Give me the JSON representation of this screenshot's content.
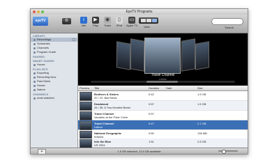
{
  "window": {
    "title": "EyeTV Programs"
  },
  "toolbar": {
    "logo_text": "eyeTV",
    "buttons": [
      {
        "label": "Info",
        "icon": "info-icon",
        "color": "#2d6fd0"
      },
      {
        "label": "Play",
        "icon": "play-icon",
        "color": "#3a3a3a"
      },
      {
        "label": "Toast",
        "icon": "toast-icon",
        "color": "#b0b0b0"
      },
      {
        "label": "iPod",
        "icon": "ipod-icon",
        "color": "#d8d8d8"
      },
      {
        "label": "Apple TV",
        "icon": "appletv-icon",
        "color": "#444"
      }
    ],
    "view_label": "View",
    "search_label": "Search"
  },
  "sidebar": {
    "sections": [
      {
        "header": "LIBRARY",
        "items": [
          {
            "label": "Recordings",
            "count": "32",
            "selected": true
          },
          {
            "label": "Schedules"
          },
          {
            "label": "Channels"
          },
          {
            "label": "Program Guide"
          }
        ]
      },
      {
        "header": "SHARED",
        "items": []
      },
      {
        "header": "SMART GUIDES",
        "items": [
          {
            "label": "House"
          }
        ]
      },
      {
        "header": "PLAYLISTS",
        "items": [
          {
            "label": "Exporting"
          },
          {
            "label": "Recording Now"
          },
          {
            "label": "Past Week"
          },
          {
            "label": "House"
          },
          {
            "label": "Nature"
          }
        ]
      },
      {
        "header": "CHANNELS",
        "items": [
          {
            "label": "most watched"
          }
        ]
      }
    ]
  },
  "coverflow": {
    "title": "Travel Channel",
    "subtitle": "Lisbon"
  },
  "table": {
    "columns": [
      "Preview",
      "Title",
      "Duration",
      "Date",
      "Size"
    ],
    "rows": [
      {
        "title": "Brothers & Sisters",
        "episode": "20 / 22: Bad News",
        "duration": "0:42",
        "date": "",
        "size": "1.5 GB",
        "state": "normal"
      },
      {
        "title": "Deadwood",
        "episode": "26 / 36: A Two-Headed Beast",
        "duration": "0:57",
        "date": "",
        "size": "1.5 GB",
        "state": "alt"
      },
      {
        "title": "Travel Channel",
        "episode": "Vacation at the Polar Circle",
        "duration": "0:57",
        "date": "",
        "size": "",
        "state": "normal"
      },
      {
        "title": "Travel Channel",
        "episode": "Lisbon",
        "duration": "0:47",
        "date": "",
        "size": "2.1 GB",
        "state": "selected"
      },
      {
        "title": "National Geographic",
        "episode": "Indiana",
        "duration": "0:50",
        "date": "",
        "size": "135 MB",
        "state": "normal"
      },
      {
        "title": "Into the Blue",
        "episode": "US 2004",
        "duration": "1:51",
        "date": "",
        "size": "2.8 GB",
        "state": "alt"
      }
    ]
  },
  "status": {
    "text": "1.9 GB selected, 13.9 GB available"
  },
  "zoom": {
    "level": 0.25
  }
}
